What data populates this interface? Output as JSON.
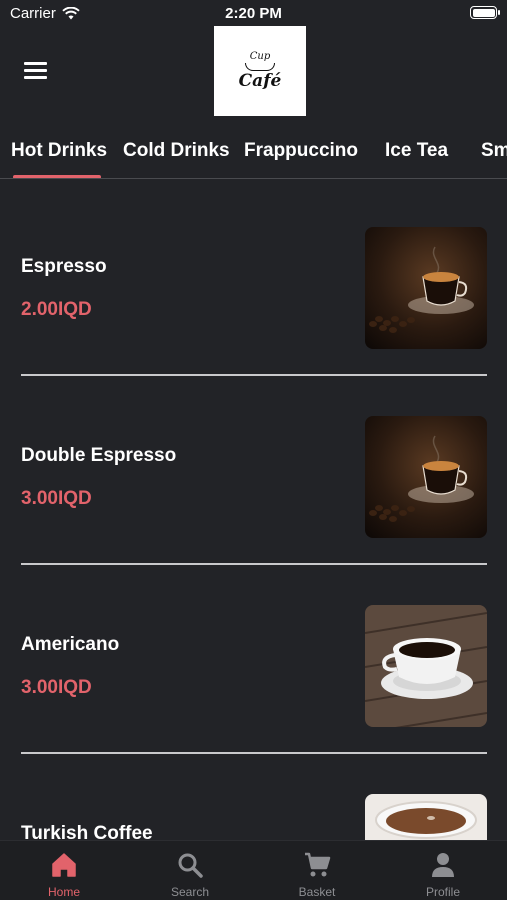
{
  "status_bar": {
    "carrier": "Carrier",
    "time": "2:20 PM"
  },
  "header": {
    "logo_top": "Cup",
    "logo_text": "Café"
  },
  "category_tabs": [
    {
      "label": "Hot Drinks",
      "active": true
    },
    {
      "label": "Cold Drinks",
      "active": false
    },
    {
      "label": "Frappuccino",
      "active": false
    },
    {
      "label": "Ice Tea",
      "active": false
    },
    {
      "label": "Sm",
      "active": false
    }
  ],
  "menu_items": [
    {
      "name": "Espresso",
      "price": "2.00IQD",
      "image": "espresso-cup-with-beans"
    },
    {
      "name": "Double Espresso",
      "price": "3.00IQD",
      "image": "espresso-cup-with-beans"
    },
    {
      "name": "Americano",
      "price": "3.00IQD",
      "image": "americano-cup-on-wood"
    },
    {
      "name": "Turkish Coffee",
      "price": "",
      "image": "turkish-coffee-cup"
    }
  ],
  "bottom_nav": [
    {
      "label": "Home",
      "icon": "home-icon",
      "active": true
    },
    {
      "label": "Search",
      "icon": "search-icon",
      "active": false
    },
    {
      "label": "Basket",
      "icon": "cart-icon",
      "active": false
    },
    {
      "label": "Profile",
      "icon": "profile-icon",
      "active": false
    }
  ],
  "colors": {
    "background": "#222327",
    "accent": "#e2636b",
    "tab_bar": "#1e1f22"
  }
}
